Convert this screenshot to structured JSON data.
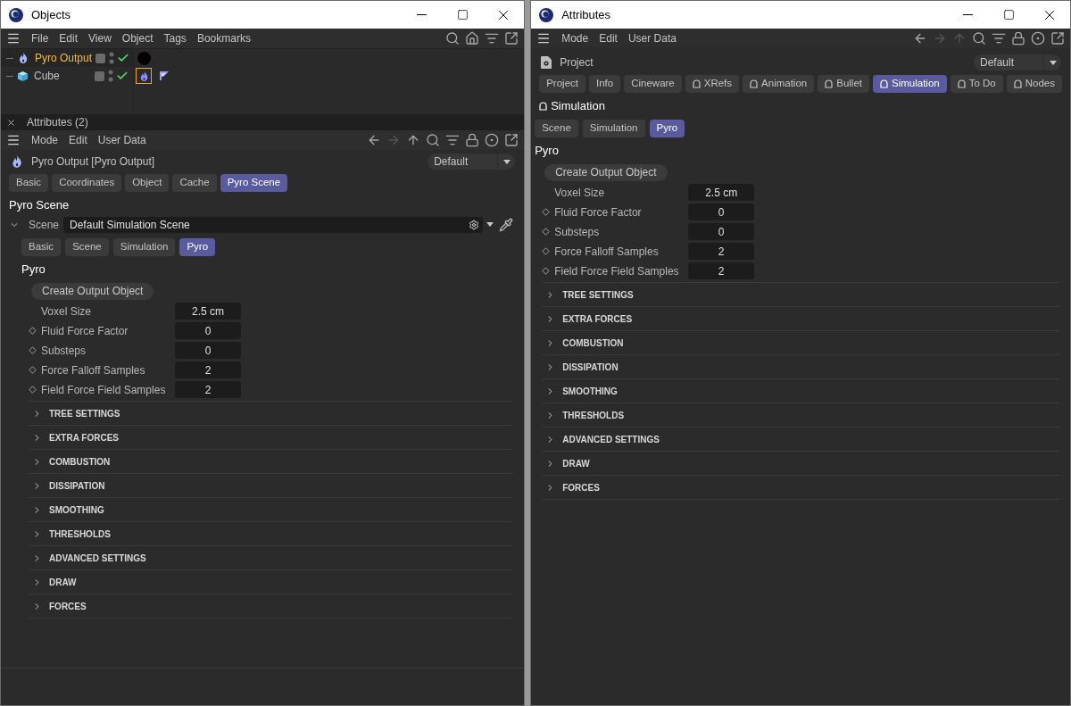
{
  "objects_window": {
    "title": "Objects",
    "menu": [
      "File",
      "Edit",
      "View",
      "Object",
      "Tags",
      "Bookmarks"
    ],
    "objects": [
      {
        "name": "Pyro Output",
        "kind": "pyro",
        "selected": true,
        "tags": [
          {
            "kind": "material",
            "selected": false
          }
        ]
      },
      {
        "name": "Cube",
        "kind": "cube",
        "selected": false,
        "tags": [
          {
            "kind": "pyro",
            "selected": true
          },
          {
            "kind": "flag",
            "selected": false
          }
        ]
      }
    ],
    "attributes": {
      "title": "Attributes (2)",
      "menu": [
        "Mode",
        "Edit",
        "User Data"
      ],
      "object_name": "Pyro Output [Pyro Output]",
      "preset": "Default",
      "tabs": [
        {
          "label": "Basic",
          "selected": false,
          "locked": false
        },
        {
          "label": "Coordinates",
          "selected": false,
          "locked": false
        },
        {
          "label": "Object",
          "selected": false,
          "locked": false
        },
        {
          "label": "Cache",
          "selected": false,
          "locked": false
        },
        {
          "label": "Pyro Scene",
          "selected": true,
          "locked": false
        }
      ],
      "section_title": "Pyro Scene",
      "section_locked": false,
      "scene_field": {
        "label": "Scene",
        "value": "Default Simulation Scene",
        "expanded": true
      },
      "subtabs": [
        {
          "label": "Basic",
          "selected": false
        },
        {
          "label": "Scene",
          "selected": false
        },
        {
          "label": "Simulation",
          "selected": false
        },
        {
          "label": "Pyro",
          "selected": true
        }
      ],
      "group_title": "Pyro",
      "button": "Create Output Object",
      "params": [
        {
          "label": "Voxel Size",
          "value": "2.5 cm",
          "keyframe": false
        },
        {
          "label": "Fluid Force Factor",
          "value": "0",
          "keyframe": true
        },
        {
          "label": "Substeps",
          "value": "0",
          "keyframe": true
        },
        {
          "label": "Force Falloff Samples",
          "value": "2",
          "keyframe": true
        },
        {
          "label": "Field Force Field Samples",
          "value": "2",
          "keyframe": true
        }
      ],
      "sections": [
        {
          "label": "TREE SETTINGS",
          "expanded": false
        },
        {
          "label": "EXTRA FORCES",
          "expanded": false
        },
        {
          "label": "COMBUSTION",
          "expanded": false
        },
        {
          "label": "DISSIPATION",
          "expanded": false
        },
        {
          "label": "SMOOTHING",
          "expanded": false
        },
        {
          "label": "THRESHOLDS",
          "expanded": false
        },
        {
          "label": "ADVANCED SETTINGS",
          "expanded": false
        },
        {
          "label": "DRAW",
          "expanded": false
        },
        {
          "label": "FORCES",
          "expanded": false
        }
      ]
    }
  },
  "attributes_window": {
    "title": "Attributes",
    "menu": [
      "Mode",
      "Edit",
      "User Data"
    ],
    "object_name": "Project",
    "preset": "Default",
    "tabs": [
      {
        "label": "Project",
        "selected": false,
        "locked": false
      },
      {
        "label": "Info",
        "selected": false,
        "locked": false
      },
      {
        "label": "Cineware",
        "selected": false,
        "locked": false
      },
      {
        "label": "XRefs",
        "selected": false,
        "locked": true
      },
      {
        "label": "Animation",
        "selected": false,
        "locked": true
      },
      {
        "label": "Bullet",
        "selected": false,
        "locked": true
      },
      {
        "label": "Simulation",
        "selected": true,
        "locked": true
      },
      {
        "label": "To Do",
        "selected": false,
        "locked": true
      },
      {
        "label": "Nodes",
        "selected": false,
        "locked": true
      }
    ],
    "section_title": "Simulation",
    "section_locked": true,
    "subtabs": [
      {
        "label": "Scene",
        "selected": false
      },
      {
        "label": "Simulation",
        "selected": false
      },
      {
        "label": "Pyro",
        "selected": true
      }
    ],
    "group_title": "Pyro",
    "button": "Create Output Object",
    "params": [
      {
        "label": "Voxel Size",
        "value": "2.5 cm",
        "keyframe": false
      },
      {
        "label": "Fluid Force Factor",
        "value": "0",
        "keyframe": true
      },
      {
        "label": "Substeps",
        "value": "0",
        "keyframe": true
      },
      {
        "label": "Force Falloff Samples",
        "value": "2",
        "keyframe": true
      },
      {
        "label": "Field Force Field Samples",
        "value": "2",
        "keyframe": true
      }
    ],
    "sections": [
      {
        "label": "TREE SETTINGS",
        "expanded": false
      },
      {
        "label": "EXTRA FORCES",
        "expanded": false
      },
      {
        "label": "COMBUSTION",
        "expanded": false
      },
      {
        "label": "DISSIPATION",
        "expanded": false
      },
      {
        "label": "SMOOTHING",
        "expanded": false
      },
      {
        "label": "THRESHOLDS",
        "expanded": false
      },
      {
        "label": "ADVANCED SETTINGS",
        "expanded": false
      },
      {
        "label": "DRAW",
        "expanded": false
      },
      {
        "label": "FORCES",
        "expanded": false
      }
    ]
  }
}
